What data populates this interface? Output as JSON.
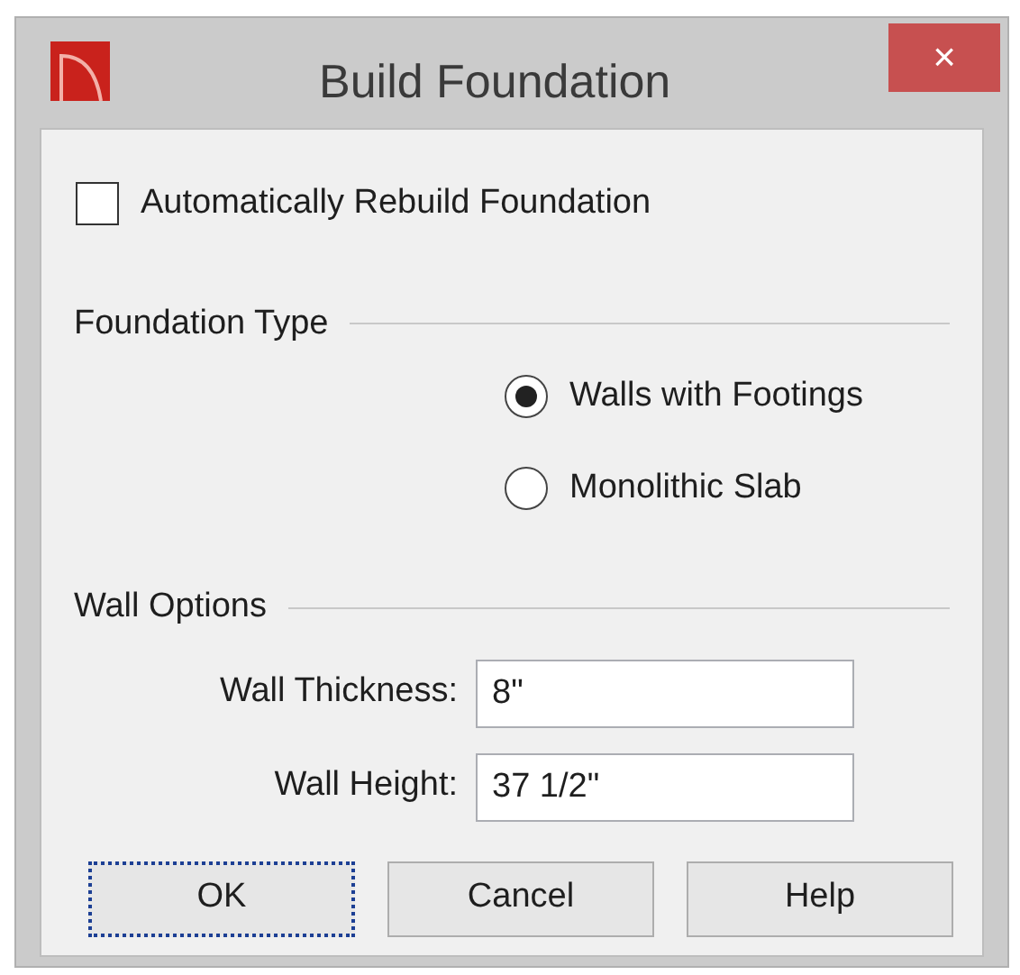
{
  "window": {
    "title": "Build Foundation",
    "close": "×"
  },
  "auto_rebuild": {
    "label": "Automatically Rebuild Foundation",
    "checked": false
  },
  "foundation_type": {
    "heading": "Foundation Type",
    "options": [
      {
        "label": "Walls with Footings",
        "selected": true
      },
      {
        "label": "Monolithic Slab",
        "selected": false
      }
    ]
  },
  "wall_options": {
    "heading": "Wall Options",
    "fields": [
      {
        "label": "Wall Thickness:",
        "value": "8\""
      },
      {
        "label": "Wall Height:",
        "value": "37 1/2\""
      }
    ]
  },
  "buttons": [
    {
      "label": "OK",
      "focused": true
    },
    {
      "label": "Cancel",
      "focused": false
    },
    {
      "label": "Help",
      "focused": false
    }
  ]
}
